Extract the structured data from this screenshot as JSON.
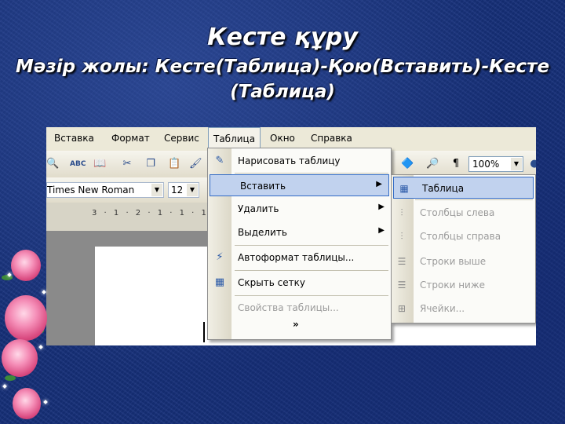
{
  "slide": {
    "title": "Кесте құру",
    "subtitle_line1": "Мәзір жолы: Кесте(Таблица)-Қою(Вставить)-Кесте",
    "subtitle_line2": "(Таблица)"
  },
  "menubar": [
    "Вставка",
    "Формат",
    "Сервис",
    "Таблица",
    "Окно",
    "Справка"
  ],
  "toolbar": {
    "zoom": "100%",
    "font": "Times New Roman",
    "size": "12",
    "ruler": "3 · 1 · 2 · 1 · 1 · 1 ·"
  },
  "table_menu": [
    {
      "label": "Нарисовать таблицу",
      "icon": "pencil-icon"
    },
    {
      "label": "Вставить",
      "submenu": true
    },
    {
      "label": "Удалить",
      "submenu": true
    },
    {
      "label": "Выделить",
      "submenu": true
    },
    {
      "label": "Автоформат таблицы...",
      "icon": "autoformat-icon"
    },
    {
      "label": "Скрыть сетку",
      "icon": "grid-icon"
    },
    {
      "label": "Свойства таблицы...",
      "disabled": true
    },
    {
      "label": "»"
    }
  ],
  "insert_submenu": [
    {
      "label": "Таблица",
      "icon": "table-icon"
    },
    {
      "label": "Столбцы слева",
      "disabled": true
    },
    {
      "label": "Столбцы справа",
      "disabled": true
    },
    {
      "label": "Строки выше",
      "disabled": true
    },
    {
      "label": "Строки ниже",
      "disabled": true
    },
    {
      "label": "Ячейки...",
      "disabled": true
    }
  ],
  "colors": {
    "background": "#16307a",
    "highlight": "#c1d2ee",
    "highlight_border": "#316ac5"
  }
}
